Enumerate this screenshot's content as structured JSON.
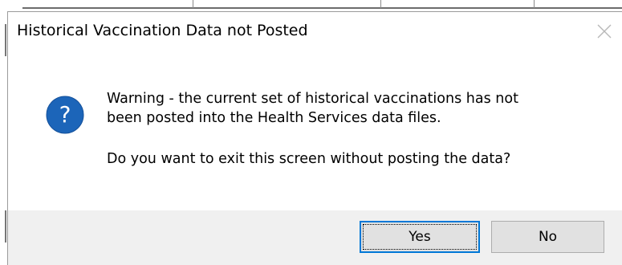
{
  "dialog": {
    "title": "Historical Vaccination Data not Posted",
    "close_icon": "close-icon",
    "icon": "question-icon",
    "icon_color": "#1c65b9",
    "message_line_1": "Warning - the current set of historical vaccinations has not",
    "message_line_2": "been posted into the Health Services data files.",
    "question": "Do you want to exit this screen without posting the data?",
    "buttons": {
      "yes_label": "Yes",
      "no_label": "No"
    },
    "default_button": "Yes",
    "accent_color": "#0078d7",
    "button_bar_color": "#f0f0f0"
  }
}
